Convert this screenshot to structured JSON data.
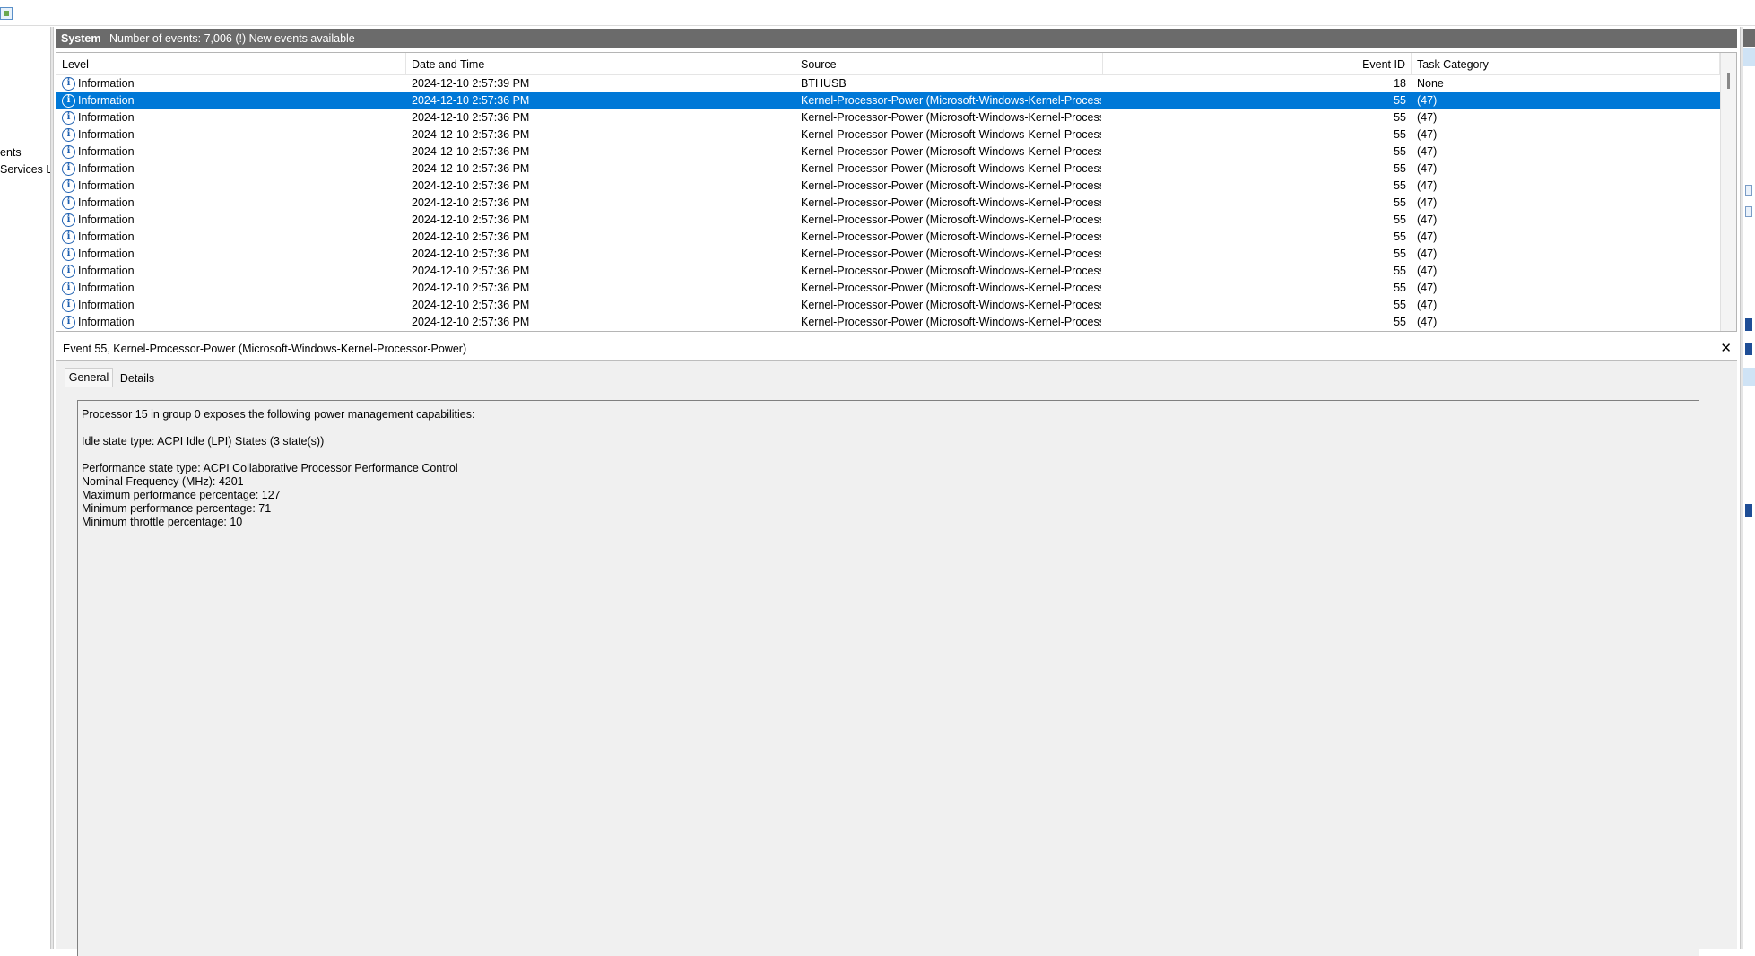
{
  "left_tree": {
    "items": [
      "ents",
      "Services Lo"
    ]
  },
  "header": {
    "title": "System",
    "count_text": "Number of events: 7,006 (!) New events available"
  },
  "grid": {
    "columns": {
      "level": "Level",
      "datetime": "Date and Time",
      "source": "Source",
      "event_id": "Event ID",
      "task_category": "Task Category"
    },
    "rows": [
      {
        "level": "Information",
        "datetime": "2024-12-10 2:57:39 PM",
        "source": "BTHUSB",
        "event_id": "18",
        "task": "None"
      },
      {
        "level": "Information",
        "datetime": "2024-12-10 2:57:36 PM",
        "source": "Kernel-Processor-Power (Microsoft-Windows-Kernel-Process...",
        "event_id": "55",
        "task": "(47)"
      },
      {
        "level": "Information",
        "datetime": "2024-12-10 2:57:36 PM",
        "source": "Kernel-Processor-Power (Microsoft-Windows-Kernel-Process...",
        "event_id": "55",
        "task": "(47)"
      },
      {
        "level": "Information",
        "datetime": "2024-12-10 2:57:36 PM",
        "source": "Kernel-Processor-Power (Microsoft-Windows-Kernel-Process...",
        "event_id": "55",
        "task": "(47)"
      },
      {
        "level": "Information",
        "datetime": "2024-12-10 2:57:36 PM",
        "source": "Kernel-Processor-Power (Microsoft-Windows-Kernel-Process...",
        "event_id": "55",
        "task": "(47)"
      },
      {
        "level": "Information",
        "datetime": "2024-12-10 2:57:36 PM",
        "source": "Kernel-Processor-Power (Microsoft-Windows-Kernel-Process...",
        "event_id": "55",
        "task": "(47)"
      },
      {
        "level": "Information",
        "datetime": "2024-12-10 2:57:36 PM",
        "source": "Kernel-Processor-Power (Microsoft-Windows-Kernel-Process...",
        "event_id": "55",
        "task": "(47)"
      },
      {
        "level": "Information",
        "datetime": "2024-12-10 2:57:36 PM",
        "source": "Kernel-Processor-Power (Microsoft-Windows-Kernel-Process...",
        "event_id": "55",
        "task": "(47)"
      },
      {
        "level": "Information",
        "datetime": "2024-12-10 2:57:36 PM",
        "source": "Kernel-Processor-Power (Microsoft-Windows-Kernel-Process...",
        "event_id": "55",
        "task": "(47)"
      },
      {
        "level": "Information",
        "datetime": "2024-12-10 2:57:36 PM",
        "source": "Kernel-Processor-Power (Microsoft-Windows-Kernel-Process...",
        "event_id": "55",
        "task": "(47)"
      },
      {
        "level": "Information",
        "datetime": "2024-12-10 2:57:36 PM",
        "source": "Kernel-Processor-Power (Microsoft-Windows-Kernel-Process...",
        "event_id": "55",
        "task": "(47)"
      },
      {
        "level": "Information",
        "datetime": "2024-12-10 2:57:36 PM",
        "source": "Kernel-Processor-Power (Microsoft-Windows-Kernel-Process...",
        "event_id": "55",
        "task": "(47)"
      },
      {
        "level": "Information",
        "datetime": "2024-12-10 2:57:36 PM",
        "source": "Kernel-Processor-Power (Microsoft-Windows-Kernel-Process...",
        "event_id": "55",
        "task": "(47)"
      },
      {
        "level": "Information",
        "datetime": "2024-12-10 2:57:36 PM",
        "source": "Kernel-Processor-Power (Microsoft-Windows-Kernel-Process...",
        "event_id": "55",
        "task": "(47)"
      },
      {
        "level": "Information",
        "datetime": "2024-12-10 2:57:36 PM",
        "source": "Kernel-Processor-Power (Microsoft-Windows-Kernel-Process...",
        "event_id": "55",
        "task": "(47)"
      }
    ],
    "selected_row": 1,
    "level_icon": "info-icon"
  },
  "detail": {
    "title": "Event 55, Kernel-Processor-Power (Microsoft-Windows-Kernel-Processor-Power)",
    "close_glyph": "✕",
    "tabs": {
      "general": "General",
      "details": "Details"
    },
    "description": [
      "Processor 15 in group 0 exposes the following power management capabilities:",
      "",
      "Idle state type: ACPI Idle (LPI) States (3 state(s))",
      "",
      "Performance state type: ACPI Collaborative Processor Performance Control",
      "Nominal Frequency (MHz): 4201",
      "Maximum performance percentage: 127",
      "Minimum performance percentage: 71",
      "Minimum throttle percentage: 10"
    ]
  },
  "colors": {
    "selection": "#0078d7",
    "header_bar": "#6b6b6b",
    "detail_bg": "#f0f0f0",
    "info_icon": "#1d5fb0"
  }
}
